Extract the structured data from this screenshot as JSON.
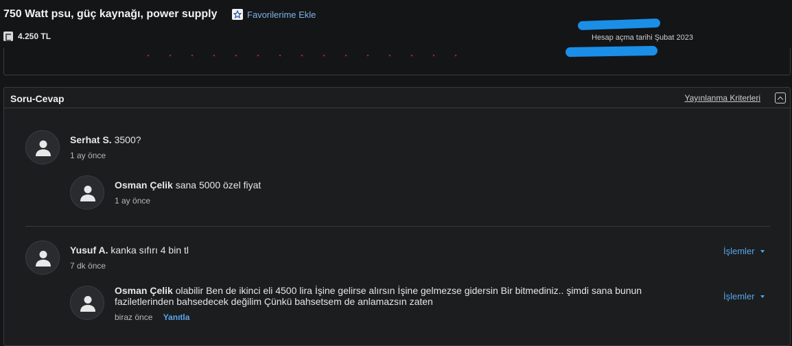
{
  "listing": {
    "title": "750 Watt psu, güç kaynağı, power supply",
    "favorite_label": "Favorilerime Ekle",
    "price": "4.250 TL"
  },
  "seller": {
    "joined": "Hesap açma tarihi  Şubat 2023"
  },
  "qa": {
    "title": "Soru-Cevap",
    "criteria_link": "Yayınlanma Kriterleri",
    "threads": [
      {
        "question": {
          "author": "Serhat S.",
          "text": "3500?",
          "time": "1 ay önce"
        },
        "answer": {
          "author": "Osman Çelik",
          "text": "sana 5000 özel fiyat",
          "time": "1 ay önce"
        }
      },
      {
        "question": {
          "author": "Yusuf A.",
          "text": "kanka sıfırı 4 bin tl",
          "time": "7 dk önce",
          "actions_label": "İşlemler"
        },
        "answer": {
          "author": "Osman Çelik",
          "text": "olabilir Ben de ikinci eli 4500 lira İşine gelirse alırsın İşine gelmezse gidersin Bir bitmediniz.. şimdi sana bunun faziletlerinden bahsedecek değilim Çünkü bahsetsem de anlamazsın zaten",
          "time": "biraz önce",
          "reply_label": "Yanıtla",
          "actions_label": "İşlemler"
        }
      }
    ]
  },
  "colors": {
    "background": "#141517",
    "panel": "#1c1d1f",
    "link": "#58a6ea",
    "redaction": "#1b8ee8"
  }
}
